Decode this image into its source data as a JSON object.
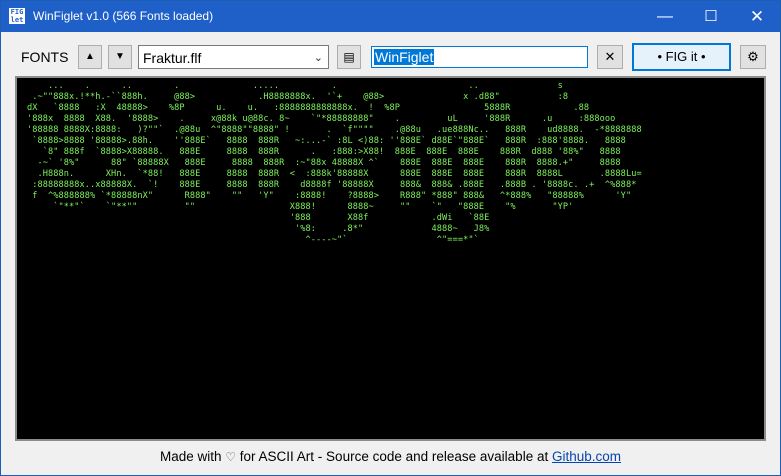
{
  "window": {
    "title": "WinFiglet v1.0 (566 Fonts loaded)",
    "app_icon_text": "FIG\nlet",
    "minimize_icon": "—",
    "maximize_icon": "☐",
    "close_icon": "✕"
  },
  "toolbar": {
    "fonts_label": "FONTS",
    "prev_font_icon": "▲",
    "next_font_icon": "▼",
    "selected_font": "Fraktur.flf",
    "dropdown_icon": "⌄",
    "save_icon": "▤",
    "input_value": "WinFiglet",
    "clear_icon": "✕",
    "figit_label": "• FIG it •",
    "settings_icon": "⚙"
  },
  "output": {
    "ascii": "    ...    .      ..        .              .....          .                         ..               s\n .~\"\"888x.!**h.-``888h.     @88>            .H8888888x.  '`+    @88>               x .d88\"           :8\ndX   `8888   :X  48888>    %8P      u.    u.   :8888888888888x.  !  %8P                5888R            .88\n'888x  8888  X88.  '8888>    .     x@88k u@88c. 8~    `\"*88888888\"    .         uL     '888R      .u     :888ooo\n'88888 8888X:8888:   )?\"\"`  .@88u  ^\"8888\"\"8888\" !       .  `f\"\"\"\"    .@88u   .ue888Nc..   888R    ud8888.  -*8888888\n `8888>8888 '88888>.88h.    ''888E`   8888  888R   ~:...-` :8L <)88: ''888E` d88E`\"888E`   888R  :888'8888.   8888\n   `8\" 888f  `8888>X88888.   888E     8888  888R      .   :888:>X88!  888E  888E  888E    888R  d888 '88%\"   8888\n  -~` '8%\"      88\" `88888X   888E     8888  888R  :~\"88x 48888X ^`    888E  888E  888E    888R  8888.+\"     8888\n  .H888n.      XHn.  `*88!   888E     8888  888R  <  :888k'88888X      888E  888E  888E    888R  8888L       .8888Lu=\n :88888888x..x88888X.  `!    888E     8888  888R    d8888f '88888X     888&  888& .888E   .888B . '8888c. .+  ^%888*\n f  ^%888888% `*88888nX\"      R888\"    \"\"   'Y\"    :8888!    ?8888>    R888\" *888\" 888&   ^*888%   \"88888%      'Y\"\n     `\"**\"`    `\"**\"\"         \"\"                  X888!      8888~     \"\"    `\"   \"888E    \"%       \"YP'\n                                                  '888       X88f            .dWi   `88E\n                                                   '%8:     .8*\"             4888~   J8%\n                                                     ^----~\"`                 ^\"===*\"`"
  },
  "footer": {
    "text_before": "Made with ",
    "heart_icon": "♡",
    "text_after": " for ASCII Art - Source code and release available at ",
    "link_label": "Github.com"
  }
}
